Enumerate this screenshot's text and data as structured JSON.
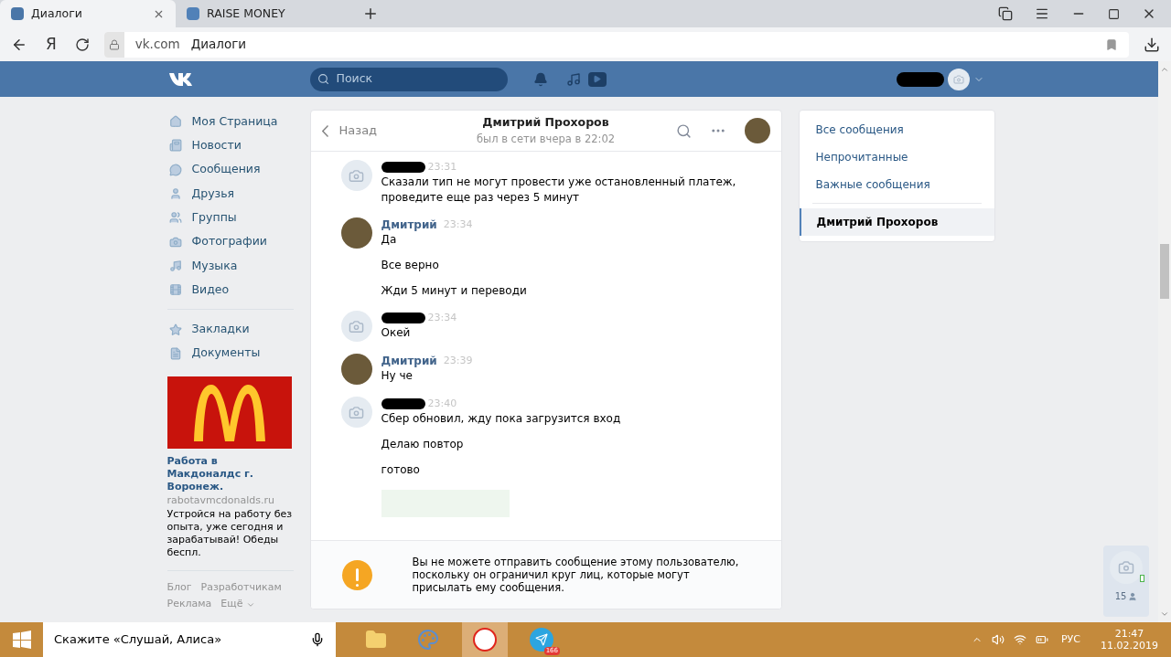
{
  "browser": {
    "tabs": [
      {
        "title": "Диалоги",
        "selected": true
      },
      {
        "title": "RAISE MONEY",
        "selected": false
      }
    ],
    "nav_letter": "Я",
    "url_host": "vk.com",
    "url_title": "Диалоги"
  },
  "header": {
    "search_placeholder": "Поиск"
  },
  "sidebar": {
    "groups": [
      [
        {
          "label": "Моя Страница"
        },
        {
          "label": "Новости"
        },
        {
          "label": "Сообщения"
        },
        {
          "label": "Друзья"
        },
        {
          "label": "Группы"
        },
        {
          "label": "Фотографии"
        },
        {
          "label": "Музыка"
        },
        {
          "label": "Видео"
        }
      ],
      [
        {
          "label": "Закладки"
        },
        {
          "label": "Документы"
        }
      ]
    ],
    "ad": {
      "title": "Работа в Макдоналдс г. Воронеж.",
      "domain": "rabotavmcdonalds.ru",
      "text": "Устройся на работу без опыта, уже сегодня и зарабатывай! Обеды беспл."
    },
    "footer_links": [
      "Блог",
      "Разработчикам",
      "Реклама",
      "Ещё"
    ]
  },
  "chat": {
    "back": "Назад",
    "name": "Дмитрий Прохоров",
    "status": "был в сети вчера в 22:02",
    "messages": [
      {
        "kind": "redacted",
        "time": "23:31",
        "lines": [
          "Сказали тип не могут провести уже остановленный платеж, проведите еще раз через 5 минут"
        ]
      },
      {
        "kind": "named",
        "author": "Дмитрий",
        "time": "23:34",
        "lines": [
          "Да",
          "Все верно",
          "Жди 5 минут и переводи"
        ]
      },
      {
        "kind": "redacted",
        "time": "23:34",
        "lines": [
          "Окей"
        ]
      },
      {
        "kind": "named",
        "author": "Дмитрий",
        "time": "23:39",
        "lines": [
          "Ну че"
        ]
      },
      {
        "kind": "redacted",
        "time": "23:40",
        "lines": [
          "Сбер обновил, жду пока загрузится вход",
          "Делаю повтор",
          "готово"
        ]
      }
    ],
    "notice": "Вы не можете отправить сообщение этому пользователю, поскольку он ограничил круг лиц, которые могут присылать ему сообщения."
  },
  "right_menu": {
    "filters": [
      {
        "label": "Все сообщения",
        "selected": false
      },
      {
        "label": "Непрочитанные",
        "selected": false
      },
      {
        "label": "Важные сообщения",
        "selected": false
      }
    ],
    "chats": [
      {
        "label": "Дмитрий Прохоров",
        "selected": true
      }
    ]
  },
  "online_widget": {
    "count": "15"
  },
  "taskbar": {
    "search": "Скажите «Слушай, Алиса»",
    "telegram_badge": "166",
    "language": "РУС",
    "time": "21:47",
    "date": "11.02.2019"
  }
}
